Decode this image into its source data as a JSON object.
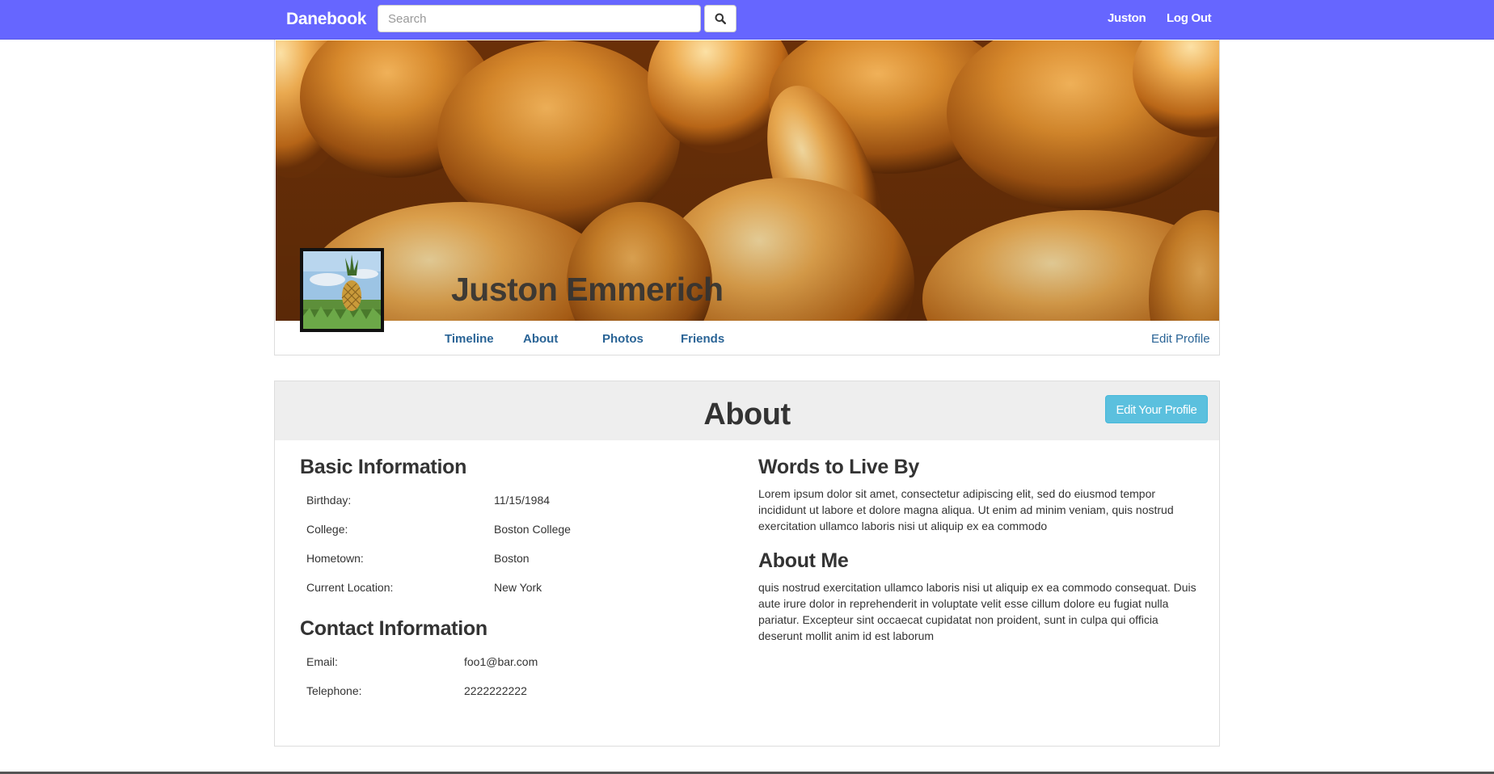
{
  "navbar": {
    "brand": "Danebook",
    "search_placeholder": "Search",
    "user_link": "Juston",
    "logout_link": "Log Out",
    "bg_color": "#6666ff"
  },
  "profile": {
    "name": "Juston Emmerich",
    "tabs": [
      {
        "label": "Timeline"
      },
      {
        "label": "About"
      },
      {
        "label": "Photos"
      },
      {
        "label": "Friends"
      }
    ],
    "edit_link": "Edit Profile"
  },
  "about": {
    "title": "About",
    "edit_button": "Edit Your Profile",
    "basic_info": {
      "heading": "Basic Information",
      "fields": [
        {
          "label": "Birthday:",
          "value": "11/15/1984"
        },
        {
          "label": "College:",
          "value": "Boston College"
        },
        {
          "label": "Hometown:",
          "value": "Boston"
        },
        {
          "label": "Current Location:",
          "value": "New York"
        }
      ]
    },
    "contact_info": {
      "heading": "Contact Information",
      "fields": [
        {
          "label": "Email:",
          "value": "foo1@bar.com"
        },
        {
          "label": "Telephone:",
          "value": "2222222222"
        }
      ]
    },
    "words_to_live_by": {
      "heading": "Words to Live By",
      "text": "Lorem ipsum dolor sit amet, consectetur adipiscing elit, sed do eiusmod tempor incididunt ut labore et dolore magna aliqua. Ut enim ad minim veniam, quis nostrud exercitation ullamco laboris nisi ut aliquip ex ea commodo"
    },
    "about_me": {
      "heading": "About Me",
      "text": "quis nostrud exercitation ullamco laboris nisi ut aliquip ex ea commodo consequat. Duis aute irure dolor in reprehenderit in voluptate velit esse cillum dolore eu fugiat nulla pariatur. Excepteur sint occaecat cupidatat non proident, sunt in culpa qui officia deserunt mollit anim id est laborum"
    }
  },
  "icons": {
    "search": "search-icon",
    "cover": "bread-rolls-cover-image",
    "avatar": "pineapple-avatar-image"
  },
  "colors": {
    "link": "#2a6496",
    "info_button": "#5bc0de",
    "panel_header": "#eeeeee"
  }
}
